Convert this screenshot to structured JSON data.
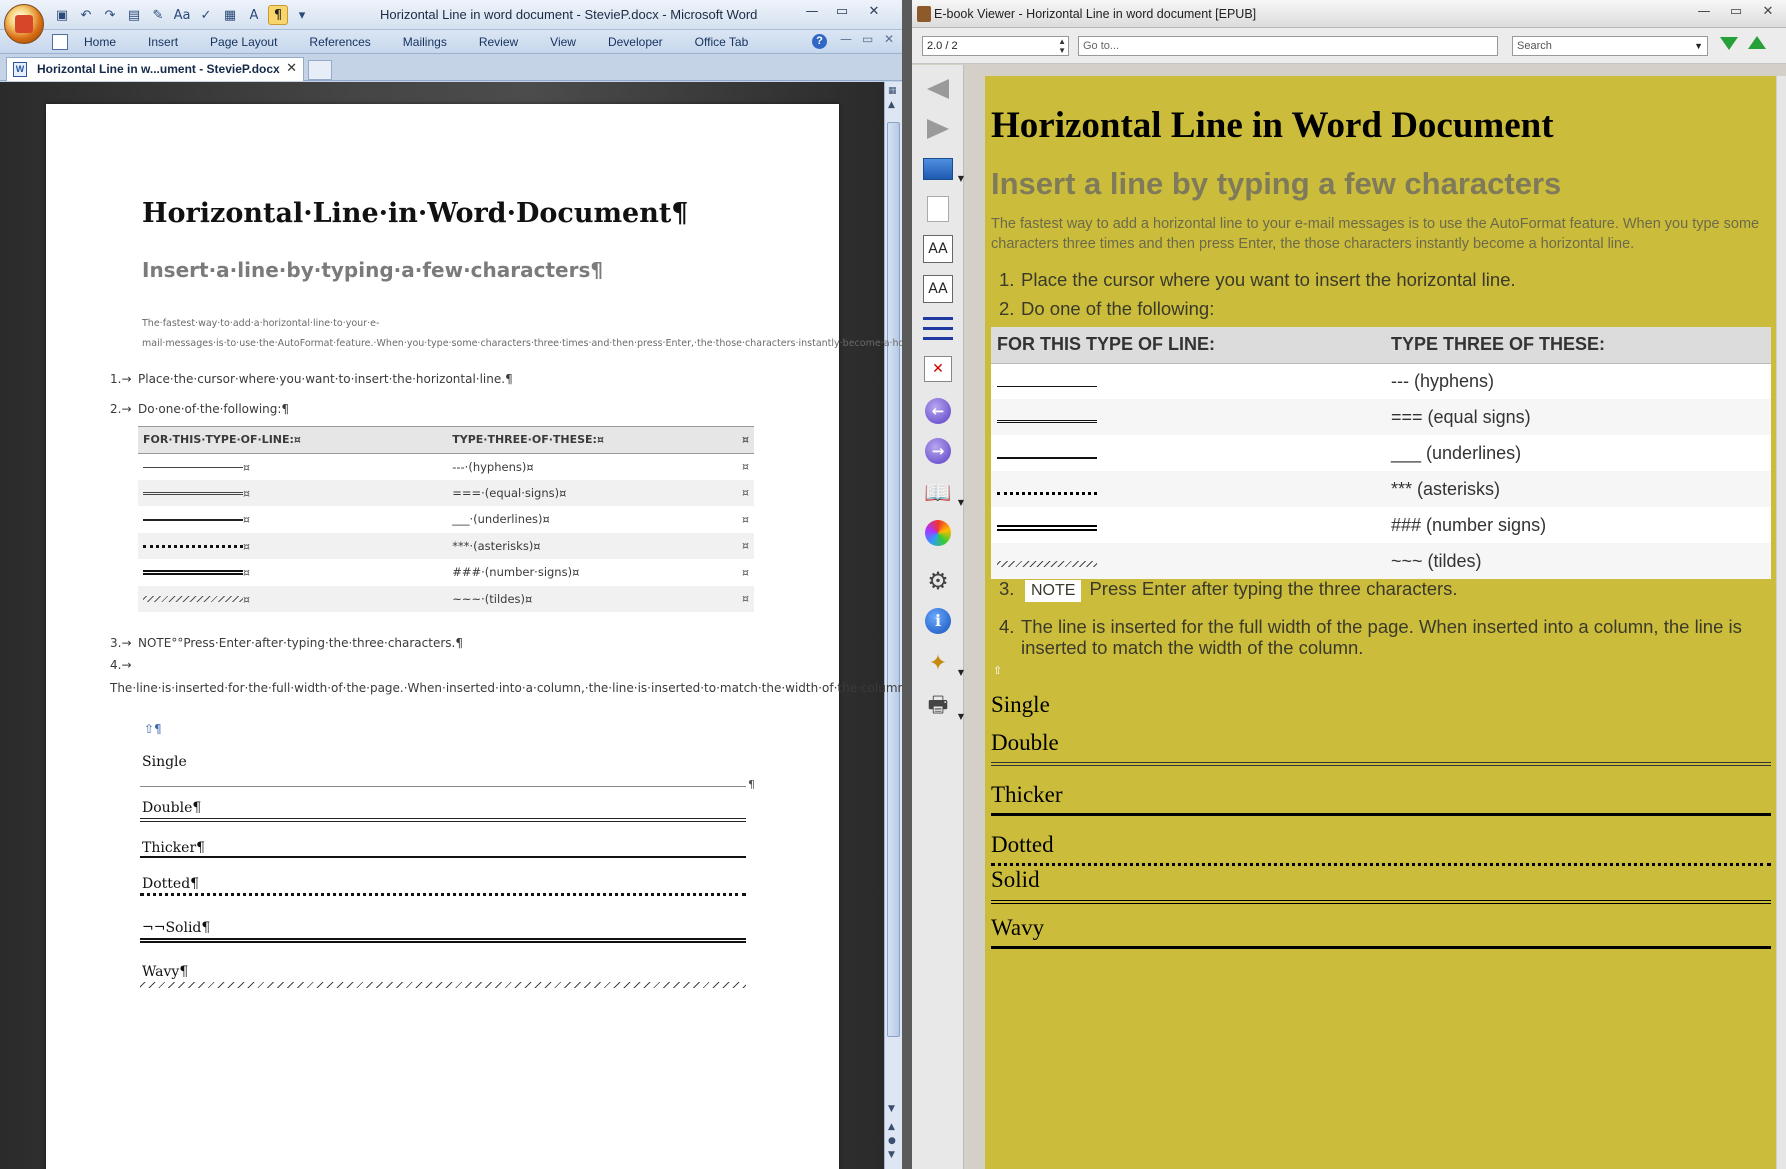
{
  "word": {
    "title": "Horizontal Line in word document - StevieP.docx - Microsoft Word",
    "ribbon_tabs": [
      "Home",
      "Insert",
      "Page Layout",
      "References",
      "Mailings",
      "Review",
      "View",
      "Developer",
      "Office Tab"
    ],
    "doc_tab": "Horizontal Line in w...ument - StevieP.docx",
    "doc_tab_close": "✕",
    "document": {
      "heading1": "Horizontal·Line·in·Word·Document¶",
      "heading2": "Insert·a·line·by·typing·a·few·characters¶",
      "intro": "The·fastest·way·to·add·a·horizontal·line·to·your·e-mail·messages·is·to·use·the·AutoFormat·feature.·When·you·type·some·characters·three·times·and·then·press·Enter,·the·those·characters·instantly·become·a·horizontal·line.¶",
      "list": [
        {
          "num": "1.→",
          "text": "Place·the·cursor·where·you·want·to·insert·the·horizontal·line.¶"
        },
        {
          "num": "2.→",
          "text": "Do·one·of·the·following:¶"
        },
        {
          "num": "3.→",
          "text": "NOTE°°Press·Enter·after·typing·the·three·characters.¶"
        },
        {
          "num": "4.→",
          "text": "The·line·is·inserted·for·the·full·width·of·the·page.·When·inserted·into·a·column,·the·line·is·inserted·to·match·the·width·of·the·column.¶"
        }
      ],
      "table": {
        "headers": [
          "FOR·THIS·TYPE·OF·LINE:¤",
          "TYPE·THREE·OF·THESE:¤"
        ],
        "end_mark": "¤",
        "rows": [
          {
            "style": "single",
            "text": "---·(hyphens)¤"
          },
          {
            "style": "double",
            "text": "===·(equal·signs)¤"
          },
          {
            "style": "underline",
            "text": "___·(underlines)¤"
          },
          {
            "style": "dotted",
            "text": "***·(asterisks)¤"
          },
          {
            "style": "thick",
            "text": "###·(number·signs)¤"
          },
          {
            "style": "wavy",
            "text": "~~~·(tildes)¤"
          }
        ]
      },
      "anchor_mark": "⇧¶",
      "sections": [
        {
          "label": "Single",
          "style": "single",
          "mark": "¶"
        },
        {
          "label": "Double¶",
          "style": "double"
        },
        {
          "label": "Thicker¶",
          "style": "thicker"
        },
        {
          "label": "Dotted¶",
          "style": "dotted"
        },
        {
          "label": "¬¬Solid¶",
          "style": "solid"
        },
        {
          "label": "Wavy¶",
          "style": "wavy"
        }
      ]
    }
  },
  "ebook": {
    "title": "E-book Viewer - Horizontal Line in word document [EPUB]",
    "position": "2.0 / 2",
    "goto_placeholder": "Go to...",
    "search_placeholder": "Search",
    "content": {
      "heading1": "Horizontal Line in Word Document",
      "heading2": "Insert a line by typing a few characters",
      "intro": "The fastest way to add a horizontal line to your e-mail messages is to use the AutoFormat feature. When you type some characters three times and then press Enter, the those characters instantly become a horizontal line.",
      "list": [
        {
          "num": "1.",
          "text": "Place the cursor where you want to insert the horizontal line."
        },
        {
          "num": "2.",
          "text": "Do one of the following:"
        },
        {
          "num": "3.",
          "badge": "NOTE",
          "text": "Press Enter after typing the three characters."
        },
        {
          "num": "4.",
          "text": "The line is inserted for the full width of the page. When inserted into a column, the line is inserted to match the width of the column."
        }
      ],
      "table": {
        "headers": [
          "FOR THIS TYPE OF LINE:",
          "TYPE THREE OF THESE:"
        ],
        "rows": [
          {
            "style": "single",
            "text": "--- (hyphens)"
          },
          {
            "style": "double",
            "text": "=== (equal signs)"
          },
          {
            "style": "underline",
            "text": "___ (underlines)"
          },
          {
            "style": "dotted",
            "text": "*** (asterisks)"
          },
          {
            "style": "thick",
            "text": "### (number signs)"
          },
          {
            "style": "wavy",
            "text": "~~~ (tildes)"
          }
        ]
      },
      "sections": [
        "Single",
        "Double",
        "Thicker",
        "Dotted",
        "Solid",
        "Wavy"
      ]
    }
  }
}
